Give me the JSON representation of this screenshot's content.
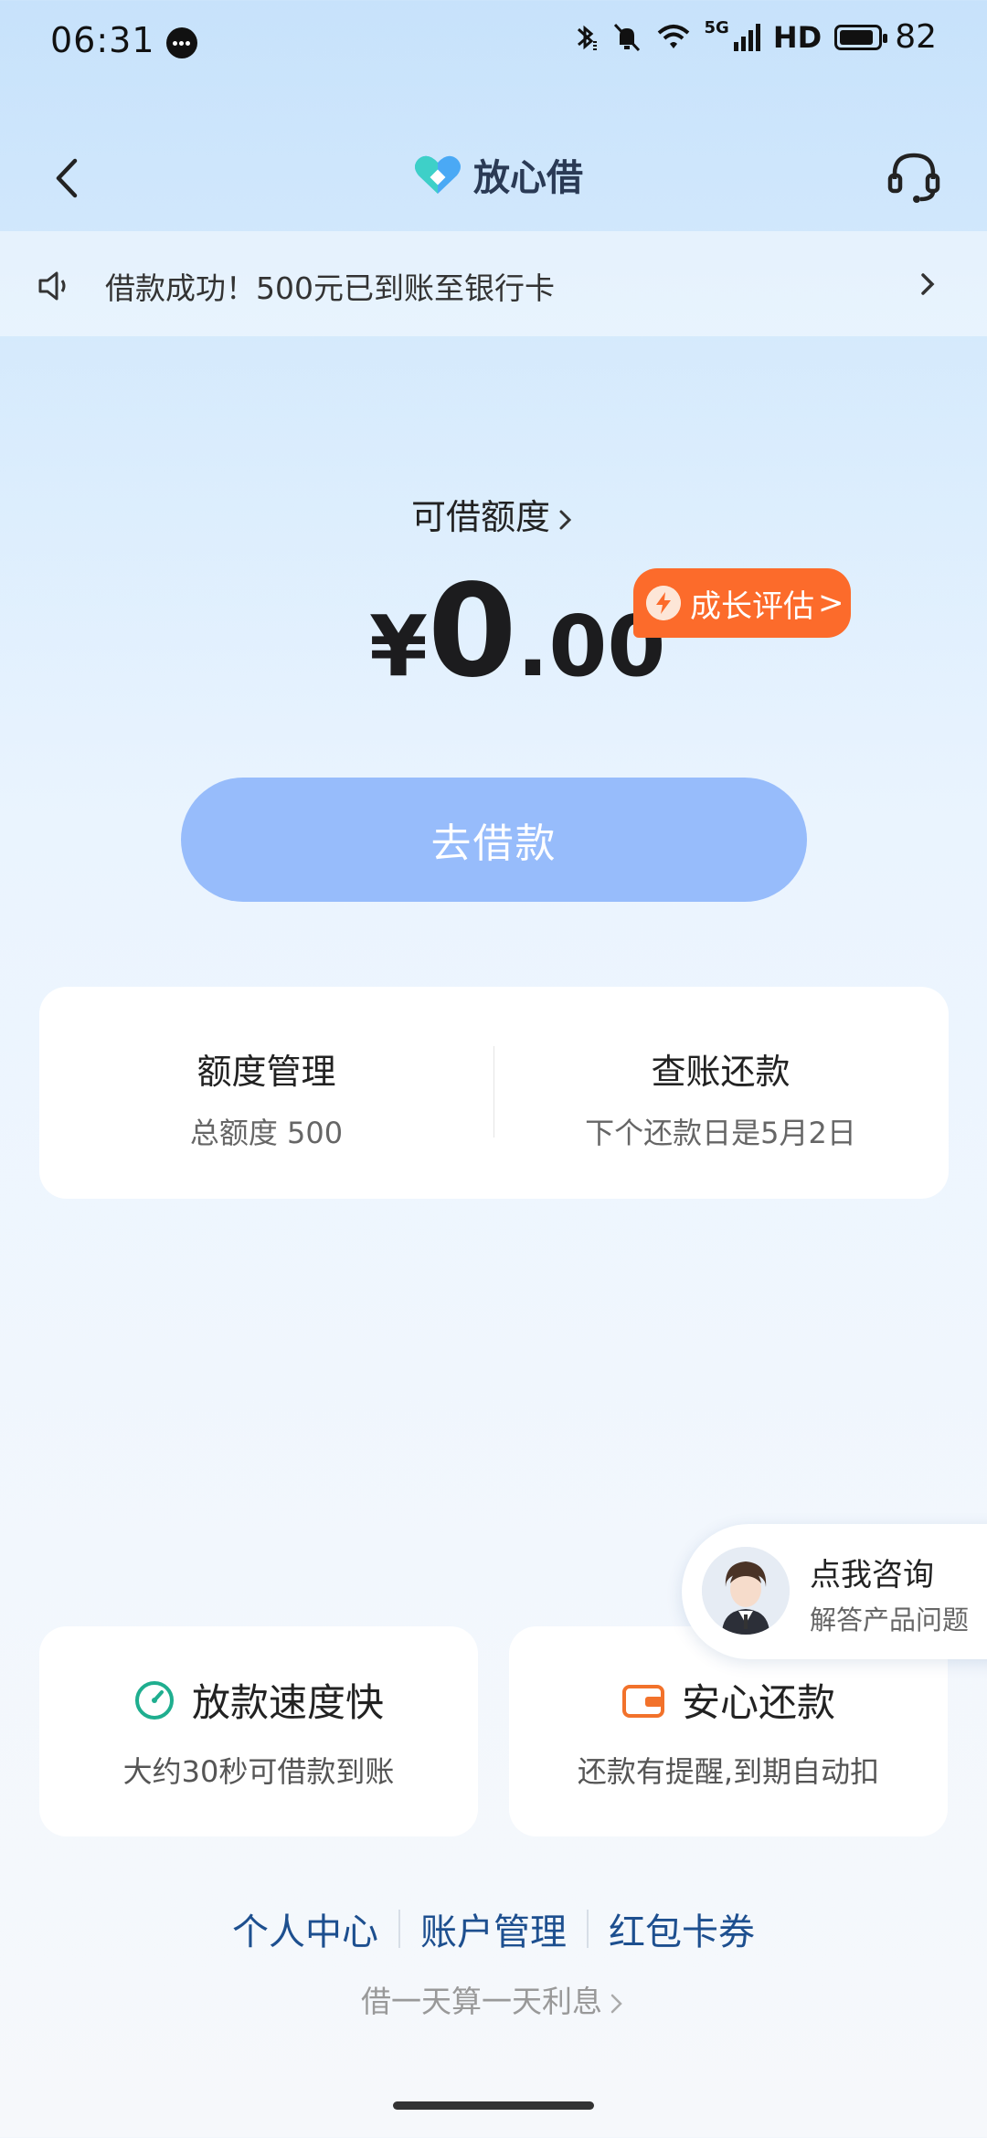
{
  "status_bar": {
    "time": "06:31",
    "network": "5G",
    "hd": "HD",
    "battery": "82",
    "battery_level": 0.82,
    "icons": [
      "message-icon",
      "bluetooth-icon",
      "mute-icon",
      "wifi-icon",
      "signal-icon",
      "battery-icon"
    ]
  },
  "header": {
    "title": "放心借",
    "back_icon": "back-arrow-icon",
    "service_icon": "headset-icon"
  },
  "notice": {
    "text": "借款成功！500元已到账至银行卡"
  },
  "credit": {
    "label": "可借额度",
    "currency": "¥",
    "integer": "0",
    "decimal": ".00",
    "badge": "成长评估",
    "badge_suffix": ">"
  },
  "borrow_button": "去借款",
  "management": {
    "left_title": "额度管理",
    "left_sub": "总额度 500",
    "right_title": "查账还款",
    "right_sub": "下个还款日是5月2日"
  },
  "consult": {
    "title": "点我咨询",
    "sub": "解答产品问题"
  },
  "features": [
    {
      "title": "放款速度快",
      "sub": "大约30秒可借款到账",
      "icon": "speed-gauge-icon"
    },
    {
      "title": "安心还款",
      "sub": "还款有提醒,到期自动扣",
      "icon": "wallet-icon"
    }
  ],
  "bottom_links": [
    "个人中心",
    "账户管理",
    "红包卡券"
  ],
  "bottom_note": "借一天算一天利息",
  "colors": {
    "accent_blue": "#97bcfb",
    "badge_orange": "#fc6b2b",
    "link_blue": "#1d4f8f",
    "feature_green": "#1fae8f",
    "feature_orange": "#f2722b"
  }
}
